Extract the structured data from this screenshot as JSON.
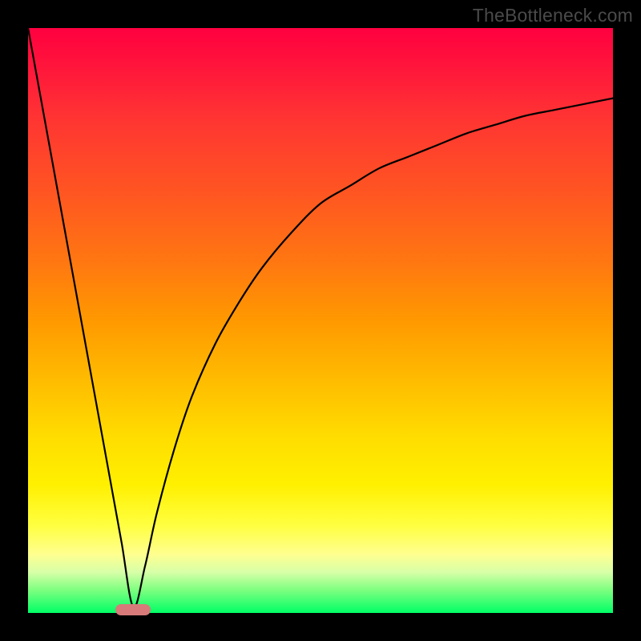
{
  "watermark": "TheBottleneck.com",
  "colors": {
    "frame": "#000000",
    "watermark": "#4a4a4a",
    "curve": "#000000",
    "marker": "#d87a7a",
    "gradient_stops": [
      "#ff0040",
      "#ff1a3a",
      "#ff3333",
      "#ff5522",
      "#ff7711",
      "#ff9900",
      "#ffbb00",
      "#ffdd00",
      "#fff000",
      "#ffff40",
      "#ffff90",
      "#d8ffa8",
      "#80ff80",
      "#00ff66"
    ]
  },
  "chart_data": {
    "type": "line",
    "title": "",
    "xlabel": "",
    "ylabel": "",
    "xlim": [
      0,
      100
    ],
    "ylim": [
      0,
      100
    ],
    "grid": false,
    "legend": false,
    "notes": "Values read off pixels; y=0 at bottom (green), y=100 at top (red). Minimum of curve at x≈18. Left branch nearly linear, right branch log-like saturating toward ~88.",
    "series": [
      {
        "name": "curve",
        "x": [
          0,
          2,
          4,
          6,
          8,
          10,
          12,
          14,
          16,
          18,
          20,
          22,
          25,
          28,
          32,
          36,
          40,
          45,
          50,
          55,
          60,
          65,
          70,
          75,
          80,
          85,
          90,
          95,
          100
        ],
        "y": [
          100,
          89,
          78,
          67,
          56,
          45,
          34,
          23,
          12,
          1,
          8,
          17,
          28,
          37,
          46,
          53,
          59,
          65,
          70,
          73,
          76,
          78,
          80,
          82,
          83.5,
          85,
          86,
          87,
          88
        ]
      }
    ],
    "marker": {
      "x": 18,
      "y": 0.5,
      "shape": "pill"
    }
  }
}
